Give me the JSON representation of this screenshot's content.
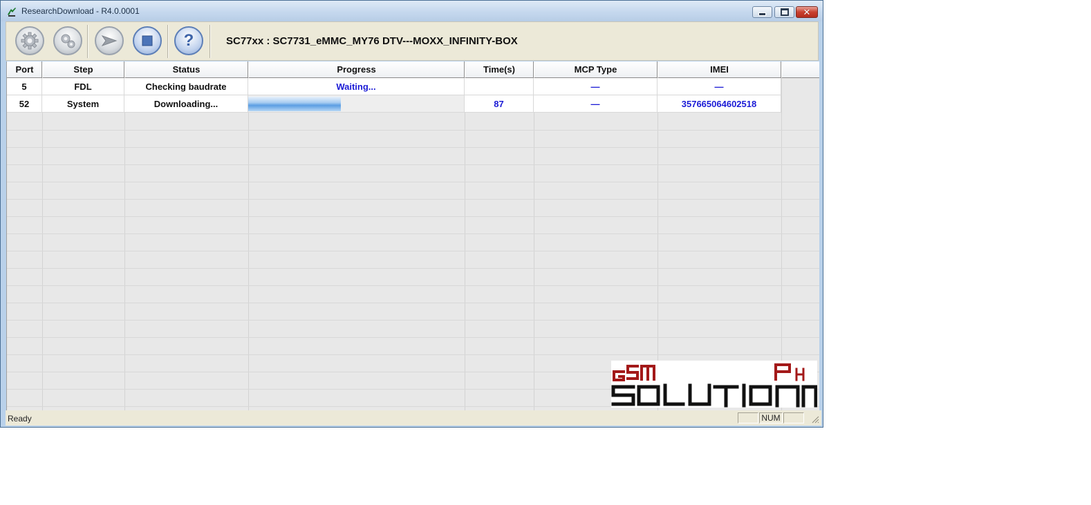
{
  "window": {
    "title": "ResearchDownload - R4.0.0001",
    "min_symbol": "",
    "max_symbol": "",
    "close_symbol": "✕"
  },
  "toolbar": {
    "buttons": [
      {
        "name": "settings",
        "icon": "gear-icon"
      },
      {
        "name": "advanced-settings",
        "icon": "gears-icon"
      },
      {
        "name": "start",
        "icon": "play-arrow-icon"
      },
      {
        "name": "stop",
        "icon": "stop-square-icon"
      },
      {
        "name": "help",
        "icon": "question-icon"
      }
    ],
    "help_glyph": "?",
    "device_label": "SC77xx : SC7731_eMMC_MY76 DTV---MOXX_INFINITY-BOX"
  },
  "table": {
    "columns": [
      "Port",
      "Step",
      "Status",
      "Progress",
      "Time(s)",
      "MCP Type",
      "IMEI"
    ],
    "rows": [
      {
        "port": "5",
        "step": "FDL",
        "status": "Checking baudrate",
        "progress_text": "Waiting...",
        "progress": null,
        "time": "",
        "mcp_type": "—",
        "imei": "—"
      },
      {
        "port": "52",
        "step": "System",
        "status": "Downloading...",
        "progress_text": "",
        "progress": 0.43,
        "time": "87",
        "mcp_type": "—",
        "imei": "357665064602518"
      }
    ]
  },
  "statusbar": {
    "text": "Ready",
    "indicators": [
      "",
      "NUM",
      ""
    ]
  },
  "watermark": {
    "line1_left": "GSM",
    "line1_right": "PH",
    "line2": "SOLUTION"
  },
  "colors": {
    "value_text": "#1b1bd6",
    "progress": "#5b9ee3",
    "logo_red": "#a31919",
    "logo_black": "#111111"
  }
}
